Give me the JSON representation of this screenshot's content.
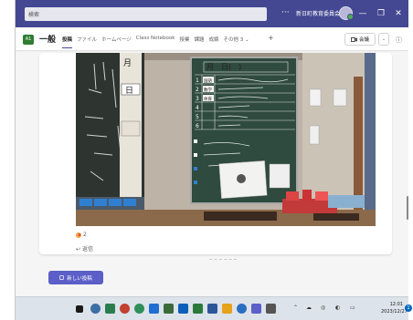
{
  "titlebar": {
    "search_placeholder": "検索",
    "more": "···",
    "org_name": "新日町教育委員会",
    "minimize": "—",
    "maximize": "❐",
    "close": "✕"
  },
  "channel": {
    "badge": "A1",
    "name": "一般",
    "tabs": [
      "投稿",
      "ファイル",
      "ホームページ",
      "Class Notebook",
      "授業",
      "課題",
      "成績",
      "その他 3 ⌄"
    ],
    "add_tab": "+",
    "meet_label": "会議",
    "meet_drop": "⌄",
    "info_icon": "ⓘ",
    "more_icon": "···"
  },
  "post": {
    "reaction_count": "2",
    "reply_label": "返信"
  },
  "photo": {
    "board_title": "月　日(　)",
    "rows": [
      "1",
      "2",
      "3",
      "4",
      "5",
      "6"
    ],
    "tags": [
      "国語",
      "数学",
      "体育",
      "",
      "",
      ""
    ],
    "month_char": "月",
    "day_char": "日"
  },
  "compose": {
    "new_post_label": "新しい投稿"
  },
  "taskbar": {
    "clock_time": "12:01",
    "clock_date": "2023/12/27",
    "notif_count": "1"
  },
  "colors": {
    "teams_purple": "#444791",
    "brand_button": "#5b5fc7",
    "chalkboard": "#2f4a3f"
  }
}
